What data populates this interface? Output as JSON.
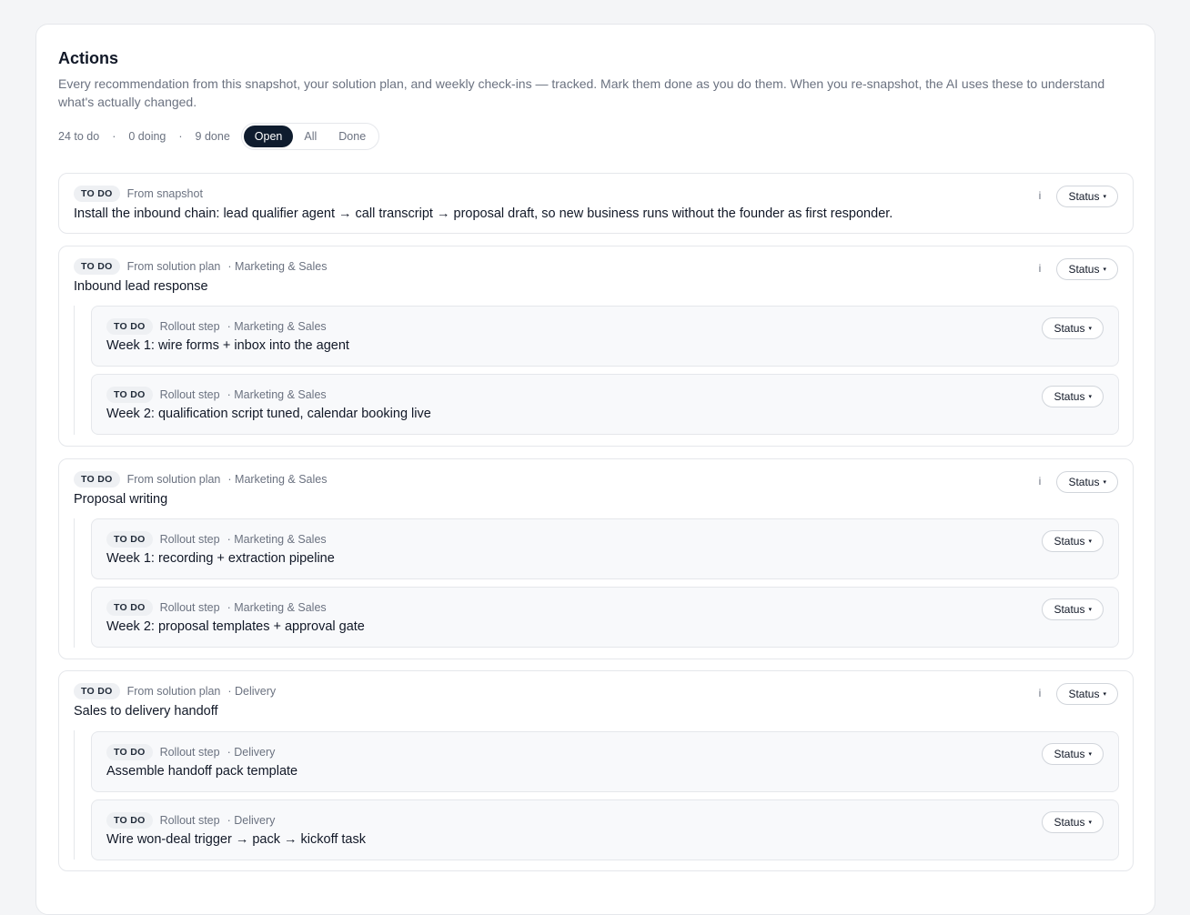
{
  "header": {
    "title": "Actions",
    "subtitle": "Every recommendation from this snapshot, your solution plan, and weekly check-ins — tracked. Mark them done as you do them. When you re-snapshot, the AI uses these to understand what's actually changed."
  },
  "counts": {
    "todo": "24 to do",
    "doing": "0 doing",
    "done": "9 done",
    "separator": "·"
  },
  "filters": {
    "open": "Open",
    "all": "All",
    "done": "Done",
    "active": "Open"
  },
  "common": {
    "status_label": "Status",
    "caret": "▾",
    "info": "i",
    "todo_badge": "TO DO"
  },
  "items": [
    {
      "badge": "TO DO",
      "source": "From snapshot",
      "category": "",
      "title": "Install the inbound chain: lead qualifier agent → call transcript → proposal draft, so new business runs without the founder as first responder.",
      "steps": []
    },
    {
      "badge": "TO DO",
      "source": "From solution plan",
      "category": "· Marketing & Sales",
      "title": "Inbound lead response",
      "steps": [
        {
          "badge": "TO DO",
          "source": "Rollout step",
          "category": "· Marketing & Sales",
          "title": "Week 1: wire forms + inbox into the agent"
        },
        {
          "badge": "TO DO",
          "source": "Rollout step",
          "category": "· Marketing & Sales",
          "title": "Week 2: qualification script tuned, calendar booking live"
        }
      ]
    },
    {
      "badge": "TO DO",
      "source": "From solution plan",
      "category": "· Marketing & Sales",
      "title": "Proposal writing",
      "steps": [
        {
          "badge": "TO DO",
          "source": "Rollout step",
          "category": "· Marketing & Sales",
          "title": "Week 1: recording + extraction pipeline"
        },
        {
          "badge": "TO DO",
          "source": "Rollout step",
          "category": "· Marketing & Sales",
          "title": "Week 2: proposal templates + approval gate"
        }
      ]
    },
    {
      "badge": "TO DO",
      "source": "From solution plan",
      "category": "· Delivery",
      "title": "Sales to delivery handoff",
      "steps": [
        {
          "badge": "TO DO",
          "source": "Rollout step",
          "category": "· Delivery",
          "title": "Assemble handoff pack template"
        },
        {
          "badge": "TO DO",
          "source": "Rollout step",
          "category": "· Delivery",
          "title": "Wire won-deal trigger → pack → kickoff task"
        }
      ]
    }
  ]
}
